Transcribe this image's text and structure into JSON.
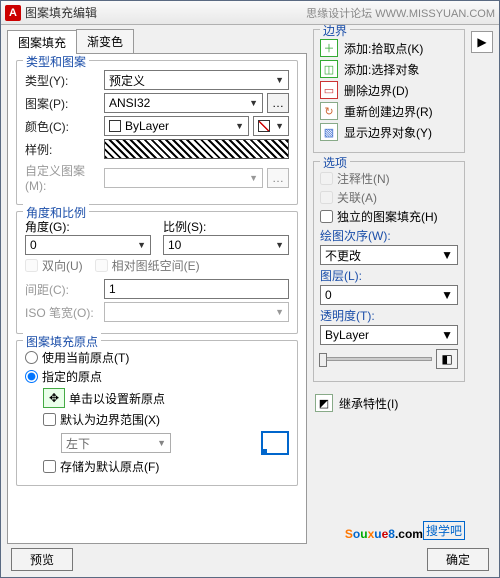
{
  "title": "图案填充编辑",
  "watermark": "思缘设计论坛 WWW.MISSYUAN.COM",
  "tabs": {
    "fill": "图案填充",
    "gradient": "渐变色"
  },
  "type_group": {
    "title": "类型和图案",
    "type_label": "类型(Y):",
    "type_value": "预定义",
    "pattern_label": "图案(P):",
    "pattern_value": "ANSI32",
    "color_label": "颜色(C):",
    "color_value": "ByLayer",
    "sample_label": "样例:",
    "custom_label": "自定义图案(M):",
    "custom_value": ""
  },
  "angle_group": {
    "title": "角度和比例",
    "angle_label": "角度(G):",
    "angle_value": "0",
    "scale_label": "比例(S):",
    "scale_value": "10",
    "double": "双向(U)",
    "paper": "相对图纸空间(E)",
    "spacing_label": "间距(C):",
    "spacing_value": "1",
    "iso_label": "ISO 笔宽(O):",
    "iso_value": ""
  },
  "origin_group": {
    "title": "图案填充原点",
    "current": "使用当前原点(T)",
    "specified": "指定的原点",
    "pick": "单击以设置新原点",
    "default_ext": "默认为边界范围(X)",
    "default_ext_value": "左下",
    "store": "存储为默认原点(F)"
  },
  "boundary": {
    "title": "边界",
    "add_pick": "添加:拾取点(K)",
    "add_select": "添加:选择对象",
    "remove": "删除边界(D)",
    "recreate": "重新创建边界(R)",
    "show": "显示边界对象(Y)"
  },
  "options": {
    "title": "选项",
    "annot": "注释性(N)",
    "assoc": "关联(A)",
    "indep": "独立的图案填充(H)",
    "order_label": "绘图次序(W):",
    "order_value": "不更改",
    "layer_label": "图层(L):",
    "layer_value": "0",
    "trans_label": "透明度(T):",
    "trans_value": "ByLayer"
  },
  "inherit": "继承特性(I)",
  "footer": {
    "preview": "预览",
    "ok": "确定"
  },
  "logo": {
    "top": "搜学吧"
  }
}
